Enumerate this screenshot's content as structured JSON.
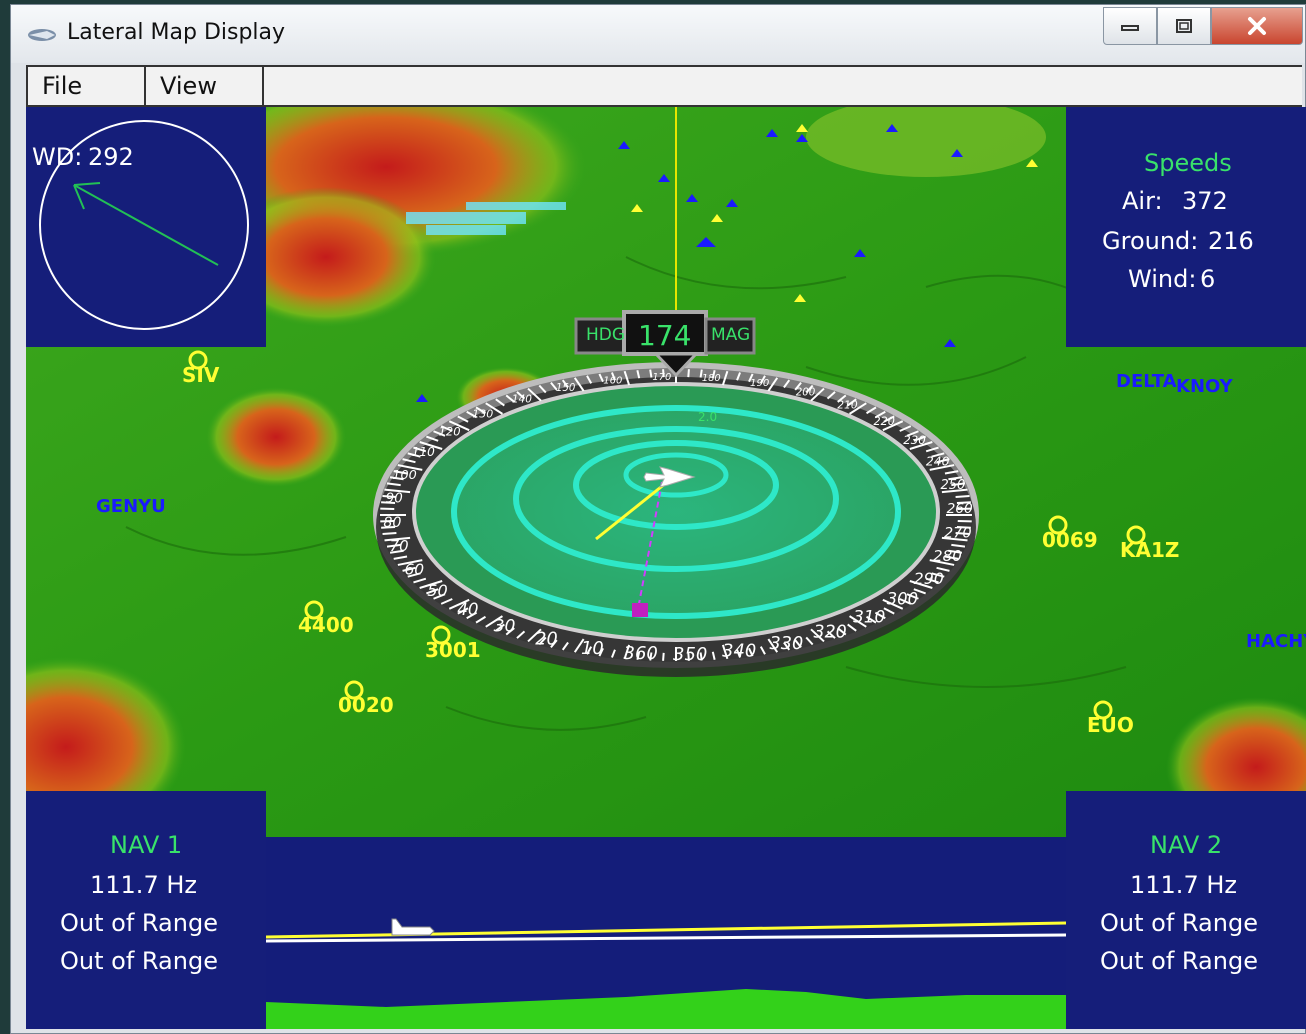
{
  "window": {
    "title": "Lateral Map Display"
  },
  "menu": {
    "file": "File",
    "view": "View"
  },
  "wind": {
    "label": "WD:",
    "value": "292"
  },
  "speeds": {
    "title": "Speeds",
    "air_label": "Air:",
    "air_value": "372",
    "ground_label": "Ground:",
    "ground_value": "216",
    "wind_label": "Wind:",
    "wind_value": "6"
  },
  "heading": {
    "hdg_label": "HDG",
    "value": "174",
    "mag_label": "MAG"
  },
  "nav1": {
    "title": "NAV 1",
    "freq": "111.7  Hz",
    "line1": "Out  of  Range",
    "line2": "Out  of  Range"
  },
  "nav2": {
    "title": "NAV 2",
    "freq": "111.7  Hz",
    "line1": "Out  of  Range",
    "line2": "Out  of  Range"
  },
  "compass": {
    "ticks": [
      "350",
      "340",
      "330",
      "320",
      "310",
      "300",
      "290",
      "280",
      "270",
      "260",
      "250",
      "240",
      "230",
      "220",
      "210",
      "200",
      "190",
      "180",
      "170",
      "160",
      "150",
      "140",
      "130",
      "120",
      "110",
      "100",
      "90",
      "80",
      "70",
      "60",
      "50",
      "40",
      "30",
      "20",
      "10",
      "360"
    ],
    "ring_label": "2.0"
  },
  "waypoints_yellow": [
    "4400",
    "3001",
    "0020",
    "EUO",
    "0069",
    "KA1Z",
    "SIV"
  ],
  "waypoints_blue": [
    "GENYU",
    "HACHY",
    "DELTA",
    "KNOY"
  ],
  "colors": {
    "panel_bg": "#151e7a",
    "accent_green": "#39e26a",
    "waypoint_yellow": "#ffff00",
    "waypoint_blue": "#1a1aff",
    "track_line": "#e6e600",
    "ring_cyan": "#2ee8c8"
  },
  "icons": {
    "title_icon": "app-logo-icon",
    "minimize": "minimize-icon",
    "maximize": "maximize-icon",
    "close": "close-icon",
    "aircraft": "aircraft-icon"
  }
}
